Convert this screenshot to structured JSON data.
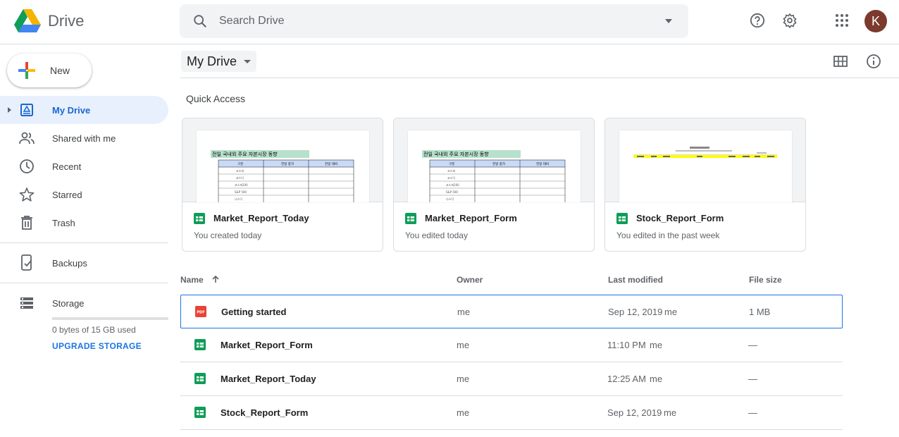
{
  "app": {
    "name": "Drive",
    "brand_colors": {
      "blue": "#4285f4",
      "green": "#0f9d58",
      "yellow": "#f4b400",
      "red": "#db4437"
    }
  },
  "header": {
    "search_placeholder": "Search Drive",
    "avatar_letter": "K",
    "icons": [
      "help-icon",
      "settings-icon",
      "apps-icon"
    ]
  },
  "sidebar": {
    "new_label": "New",
    "items": [
      {
        "label": "My Drive",
        "icon": "my-drive-icon",
        "active": true
      },
      {
        "label": "Shared with me",
        "icon": "shared-icon"
      },
      {
        "label": "Recent",
        "icon": "clock-icon"
      },
      {
        "label": "Starred",
        "icon": "star-icon"
      },
      {
        "label": "Trash",
        "icon": "trash-icon"
      },
      {
        "label": "Backups",
        "icon": "backup-icon"
      },
      {
        "label": "Storage",
        "icon": "storage-icon"
      }
    ],
    "storage_used": "0 bytes of 15 GB used",
    "upgrade_label": "UPGRADE STORAGE"
  },
  "main": {
    "title": "My Drive",
    "quick_access_title": "Quick Access",
    "quick_access": [
      {
        "name": "Market_Report_Today",
        "subtitle": "You created today",
        "preview_title": "전일 국내외 주요 자본시장 동향",
        "preview_col1": "구분",
        "preview_col2": "전일 종가",
        "preview_col3": "전일 대비",
        "preview_rows": [
          "코스피",
          "코스닥",
          "코스피200",
          "S&P 500",
          "나스닥"
        ]
      },
      {
        "name": "Market_Report_Form",
        "subtitle": "You edited today",
        "preview_title": "전일 국내외 주요 자본시장 동향",
        "preview_col1": "구분",
        "preview_col2": "전일 종가",
        "preview_col3": "전일 대비",
        "preview_rows": [
          "코스피",
          "코스닥",
          "코스피200",
          "S&P 500",
          "나스닥"
        ]
      },
      {
        "name": "Stock_Report_Form",
        "subtitle": "You edited in the past week"
      }
    ],
    "columns": {
      "name": "Name",
      "owner": "Owner",
      "modified": "Last modified",
      "size": "File size"
    },
    "files": [
      {
        "name": "Getting started",
        "type": "pdf",
        "owner": "me",
        "modified": "Sep 12, 2019",
        "modified_by": "me",
        "size": "1 MB",
        "selected": true
      },
      {
        "name": "Market_Report_Form",
        "type": "sheet",
        "owner": "me",
        "modified": "11:10 PM",
        "modified_by": "me",
        "size": "—"
      },
      {
        "name": "Market_Report_Today",
        "type": "sheet",
        "owner": "me",
        "modified": "12:25 AM",
        "modified_by": "me",
        "size": "—"
      },
      {
        "name": "Stock_Report_Form",
        "type": "sheet",
        "owner": "me",
        "modified": "Sep 12, 2019",
        "modified_by": "me",
        "size": "—"
      }
    ]
  }
}
